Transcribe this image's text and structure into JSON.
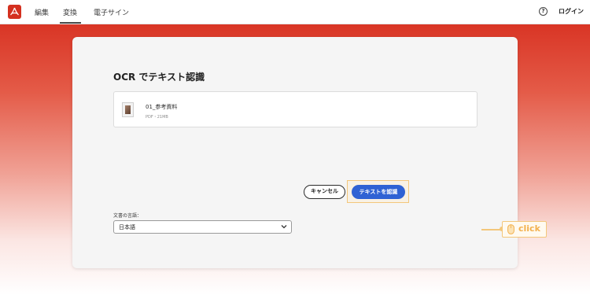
{
  "header": {
    "logo": "acrobat-icon",
    "nav": [
      {
        "label": "編集",
        "active": false
      },
      {
        "label": "変換",
        "active": true
      },
      {
        "label": "電子サイン",
        "active": false
      }
    ],
    "help_icon": "?",
    "login_label": "ログイン"
  },
  "dialog": {
    "title": "OCR でテキスト認識",
    "file": {
      "name": "01_参考資料",
      "meta": "PDF・21MB"
    },
    "language": {
      "label": "文書の言語：",
      "value": "日本語"
    },
    "cancel_label": "キャンセル",
    "primary_label": "テキストを認識"
  },
  "annotation": {
    "text": "click",
    "color": "#f3b14f"
  },
  "colors": {
    "brand": "#d4301f",
    "primary_button": "#2f62d4",
    "highlight": "#f3c77b"
  }
}
